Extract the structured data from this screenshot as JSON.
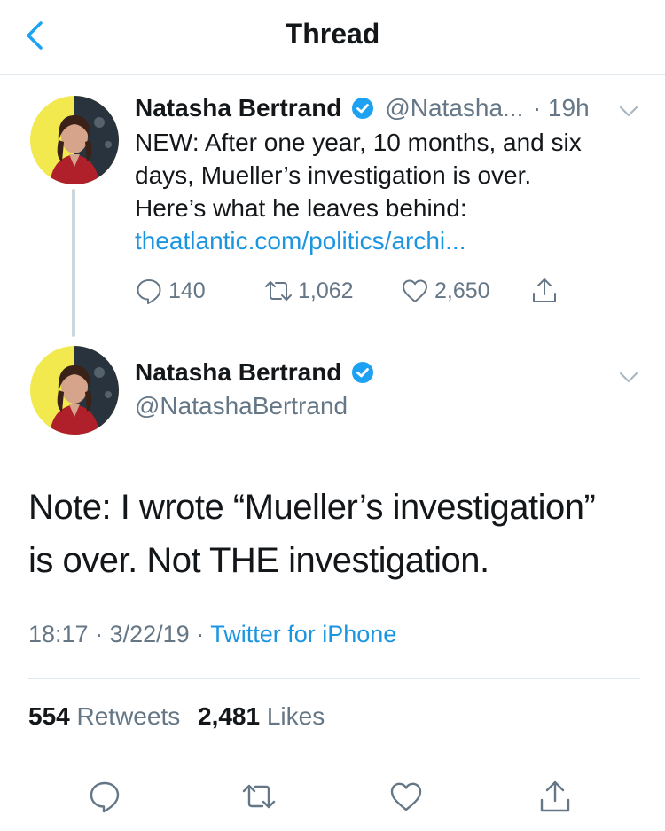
{
  "header": {
    "title": "Thread",
    "back_icon": "chevron-left-icon"
  },
  "tweet1": {
    "name": "Natasha Bertrand",
    "handle": "@Natasha...",
    "time": "· 19h",
    "text_lines": [
      "NEW: After one year, 10 months, and six",
      "days, Mueller’s investigation is over.",
      "Here’s what he leaves behind:"
    ],
    "link": "theatlantic.com/politics/archi...",
    "actions": {
      "replies": "140",
      "retweets": "1,062",
      "likes": "2,650"
    }
  },
  "tweet2": {
    "name": "Natasha Bertrand",
    "handle": "@NatashaBertrand",
    "text_lines": [
      "Note: I wrote “Mueller’s investigation”",
      "is over. Not THE investigation."
    ],
    "time": "18:17",
    "date": "3/22/19",
    "source": "Twitter for iPhone",
    "sep": "·",
    "retweet_count": "554",
    "retweet_label": "Retweets",
    "like_count": "2,481",
    "like_label": "Likes"
  },
  "colors": {
    "link": "#1b95e0",
    "muted": "#657786",
    "verified": "#1da1f2"
  }
}
